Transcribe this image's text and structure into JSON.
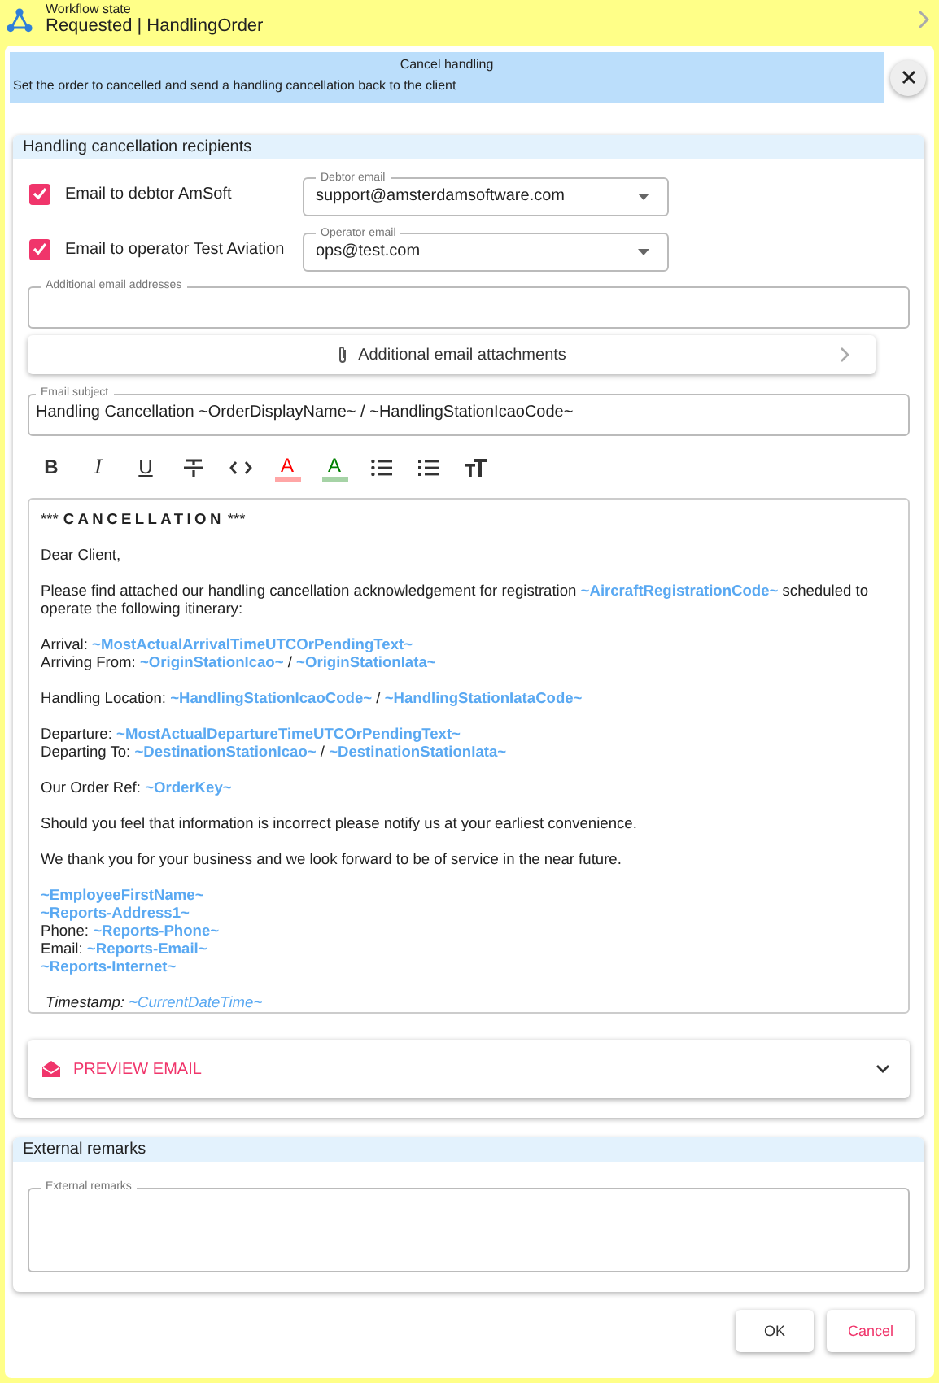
{
  "workflow": {
    "label": "Workflow state",
    "state": "Requested | HandlingOrder"
  },
  "dialog": {
    "title": "Cancel handling",
    "description": "Set the order to cancelled and send a handling cancellation back to the client"
  },
  "recipients": {
    "title": "Handling cancellation recipients",
    "rows": [
      {
        "label": "Email to debtor AmSoft",
        "checked": true,
        "field_label": "Debtor email",
        "value": "support@amsterdamsoftware.com"
      },
      {
        "label": "Email to operator Test Aviation",
        "checked": true,
        "field_label": "Operator email",
        "value": "ops@test.com"
      }
    ]
  },
  "additional_addresses": {
    "label": "Additional email addresses"
  },
  "attachments": {
    "label": "Additional email attachments"
  },
  "subject": {
    "label": "Email subject",
    "value": "Handling Cancellation ~OrderDisplayName~ / ~HandlingStationIcaoCode~"
  },
  "toolbar": [
    {
      "kind": "bold",
      "glyph": "B"
    },
    {
      "kind": "italic",
      "glyph": "I"
    },
    {
      "kind": "underline",
      "glyph": "U"
    },
    {
      "kind": "strikethrough"
    },
    {
      "kind": "code"
    },
    {
      "kind": "text-color",
      "glyph": "A",
      "color": "#ff0000"
    },
    {
      "kind": "highlight",
      "glyph": "A",
      "color": "#008000"
    },
    {
      "kind": "bullet-list"
    },
    {
      "kind": "numbered-list"
    },
    {
      "kind": "text-size"
    }
  ],
  "body": [
    [
      [
        {
          "kind": "text",
          "text": "***"
        },
        {
          "kind": "spaced",
          "text": "CANCELLATION"
        },
        {
          "kind": "text",
          "text": "***"
        }
      ]
    ],
    [
      [
        {
          "kind": "text",
          "text": "Dear Client,"
        }
      ]
    ],
    [
      [
        {
          "kind": "text",
          "text": "Please find attached our handling cancellation acknowledgement for registration "
        },
        {
          "kind": "token",
          "text": "~AircraftRegistrationCode~"
        },
        {
          "kind": "text",
          "text": " scheduled to operate the following itinerary:"
        }
      ]
    ],
    [
      [
        {
          "kind": "text",
          "text": "Arrival: "
        },
        {
          "kind": "token",
          "text": "~MostActualArrivalTimeUTCOrPendingText~"
        }
      ],
      [
        {
          "kind": "text",
          "text": "Arriving From: "
        },
        {
          "kind": "token",
          "text": "~OriginStationIcao~"
        },
        {
          "kind": "text",
          "text": " / "
        },
        {
          "kind": "token",
          "text": "~OriginStationIata~"
        }
      ]
    ],
    [
      [
        {
          "kind": "text",
          "text": "Handling Location: "
        },
        {
          "kind": "token",
          "text": "~HandlingStationIcaoCode~"
        },
        {
          "kind": "text",
          "text": " / "
        },
        {
          "kind": "token",
          "text": "~HandlingStationIataCode~"
        }
      ]
    ],
    [
      [
        {
          "kind": "text",
          "text": "Departure: "
        },
        {
          "kind": "token",
          "text": "~MostActualDepartureTimeUTCOrPendingText~"
        }
      ],
      [
        {
          "kind": "text",
          "text": "Departing To: "
        },
        {
          "kind": "token",
          "text": "~DestinationStationIcao~"
        },
        {
          "kind": "text",
          "text": " / "
        },
        {
          "kind": "token",
          "text": "~DestinationStationIata~"
        }
      ]
    ],
    [
      [
        {
          "kind": "text",
          "text": "Our Order Ref: "
        },
        {
          "kind": "token",
          "text": "~OrderKey~"
        }
      ]
    ],
    [
      [
        {
          "kind": "text",
          "text": "Should you feel that information is incorrect please notify us at your earliest convenience."
        }
      ]
    ],
    [
      [
        {
          "kind": "text",
          "text": "We thank you for your business and we look forward to be of service in the near future."
        }
      ]
    ],
    [
      [
        {
          "kind": "token",
          "text": "~EmployeeFirstName~"
        }
      ],
      [
        {
          "kind": "token",
          "text": "~Reports-Address1~"
        }
      ],
      [
        {
          "kind": "text",
          "text": "Phone: "
        },
        {
          "kind": "token",
          "text": "~Reports-Phone~"
        }
      ],
      [
        {
          "kind": "text",
          "text": "Email: "
        },
        {
          "kind": "token",
          "text": "~Reports-Email~"
        }
      ],
      [
        {
          "kind": "token",
          "text": "~Reports-Internet~"
        }
      ]
    ],
    [
      [
        {
          "kind": "stamp",
          "text": "Timestamp: "
        },
        {
          "kind": "stamp-token",
          "text": "~CurrentDateTime~"
        }
      ]
    ]
  ],
  "preview": {
    "label": "PREVIEW EMAIL"
  },
  "remarks": {
    "title": "External remarks",
    "label": "External remarks"
  },
  "buttons": [
    {
      "label": "OK",
      "kind": "default"
    },
    {
      "label": "Cancel",
      "kind": "danger"
    }
  ]
}
